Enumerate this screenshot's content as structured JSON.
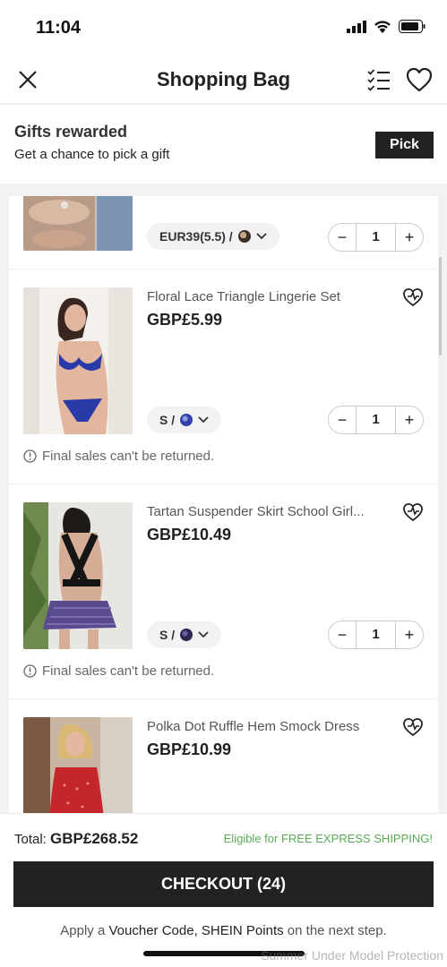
{
  "status": {
    "time": "11:04"
  },
  "header": {
    "title": "Shopping Bag"
  },
  "gifts": {
    "title": "Gifts rewarded",
    "subtitle": "Get a chance to pick a gift",
    "pick_label": "Pick"
  },
  "items": [
    {
      "name": "",
      "price": "",
      "variant": "EUR39(5.5) /",
      "quantity": "1",
      "notice": ""
    },
    {
      "name": "Floral Lace Triangle Lingerie Set",
      "price": "GBP£5.99",
      "variant": "S /",
      "quantity": "1",
      "notice": "Final sales can't be returned."
    },
    {
      "name": "Tartan Suspender Skirt School Girl...",
      "price": "GBP£10.49",
      "variant": "S /",
      "quantity": "1",
      "notice": "Final sales can't be returned."
    },
    {
      "name": "Polka Dot Ruffle Hem Smock Dress",
      "price": "GBP£10.99",
      "variant": "",
      "quantity": "",
      "notice": ""
    }
  ],
  "footer": {
    "total_label": "Total:",
    "total_value": "GBP£268.52",
    "free_shipping": "Eligible for FREE EXPRESS SHIPPING!",
    "checkout_label": "CHECKOUT (24)",
    "apply_prefix": "Apply a",
    "apply_voucher": "Voucher Code,",
    "apply_points": "SHEIN Points",
    "apply_suffix": "on the next step.",
    "watermark": "Summer Under Model Protection"
  },
  "icons": {
    "close": "close-icon",
    "list": "checklist-icon",
    "wishlist": "heart-icon",
    "item_wish": "heart-plus-icon",
    "info": "info-circle-icon"
  },
  "colors": {
    "primary": "#222222",
    "free_shipping": "#5bab56"
  }
}
